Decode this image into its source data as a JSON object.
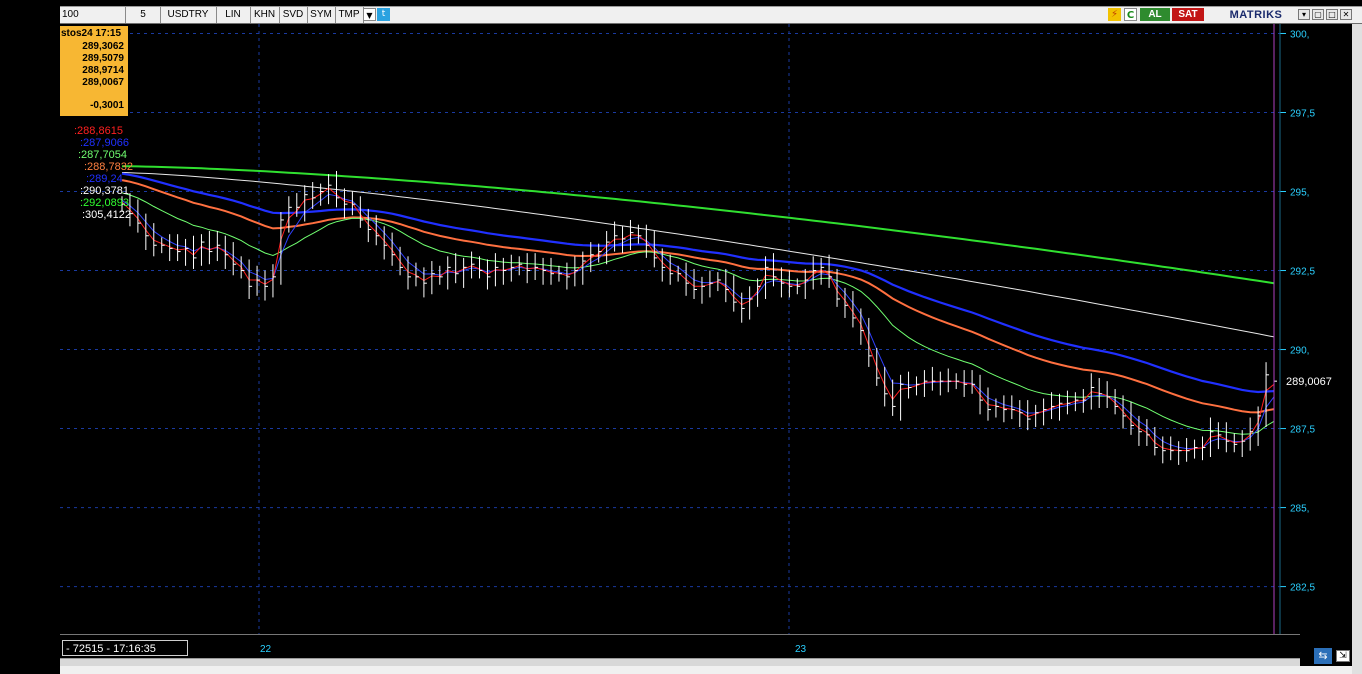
{
  "toolbar": {
    "period": "100",
    "interval": "5",
    "symbol": "USDTRY",
    "buttons": [
      "LIN",
      "KHN",
      "SVD",
      "SYM",
      "TMP"
    ],
    "buy_label": "AL",
    "sell_label": "SAT",
    "brand": "MATRIKS",
    "window_buttons": [
      "▾",
      "▢",
      "□",
      "✕"
    ]
  },
  "info": {
    "title": "stos24 17:15",
    "open": "289,3062",
    "high": "289,5079",
    "low": "288,9714",
    "close": "289,0067",
    "change": "-0,3001"
  },
  "legend": [
    {
      "text": ":288,8615",
      "color": "#ff2020"
    },
    {
      "text": ":287,9066",
      "color": "#2030ff"
    },
    {
      "text": ":287,7054",
      "color": "#70ff70"
    },
    {
      "text": ":288,7832",
      "color": "#ff8040"
    },
    {
      "text": ":289,24",
      "color": "#2030ff"
    },
    {
      "text": ":290,3781",
      "color": "#ffffff"
    },
    {
      "text": ":292,0893",
      "color": "#30ff30"
    },
    {
      "text": ":305,4122",
      "color": "#ffffff"
    }
  ],
  "status": "- 72515 - 17:16:35",
  "x_labels": [
    "22",
    "23"
  ],
  "chart_data": {
    "type": "line",
    "ylim": [
      281.0,
      300.3
    ],
    "yticks": [
      "300,",
      "297,5",
      "295,",
      "292,5",
      "290,",
      "287,5",
      "285,",
      "282,5"
    ],
    "ytick_values": [
      300,
      297.5,
      295,
      292.5,
      290,
      287.5,
      285,
      282.5
    ],
    "last_price_label": "289,0067",
    "last_price": 289.0067,
    "price_x": [
      0,
      2,
      4,
      6,
      8,
      10,
      12,
      14,
      16,
      18,
      20,
      22,
      24,
      26,
      28,
      30,
      32,
      34,
      36,
      38,
      40,
      42,
      44,
      46,
      48,
      50,
      52,
      54,
      56,
      58,
      60,
      62,
      64,
      66,
      68,
      70,
      72,
      74,
      76,
      78,
      80,
      82,
      84,
      86,
      88,
      90,
      92,
      94,
      96,
      98,
      100,
      102,
      104,
      106,
      108,
      110,
      112,
      114,
      116,
      118,
      120,
      122,
      124,
      126,
      128,
      130,
      132,
      134,
      136,
      138,
      140,
      142,
      144,
      146,
      148,
      150,
      152,
      154,
      156,
      158,
      160,
      162,
      164,
      166,
      168,
      170,
      172,
      174,
      176,
      178,
      180,
      182,
      184,
      186,
      188,
      190,
      192,
      194,
      196,
      198,
      200,
      202,
      204,
      206,
      208,
      210,
      212,
      214,
      216,
      218,
      220,
      222,
      224,
      226,
      228,
      230,
      232,
      234,
      236,
      238,
      240,
      242,
      244,
      246,
      248,
      250,
      252,
      254,
      256,
      258,
      260,
      262,
      264,
      266,
      268,
      270,
      272,
      274,
      276,
      278,
      280,
      282,
      284,
      286,
      288,
      290,
      292,
      294,
      296,
      298,
      300,
      302,
      304,
      306,
      308,
      310,
      312,
      314,
      316,
      318,
      320,
      322,
      324,
      326,
      328,
      330,
      332,
      334,
      336,
      338,
      340,
      342,
      344,
      346,
      348,
      350,
      352,
      354,
      356,
      358,
      360,
      362,
      364,
      366,
      368,
      370,
      372,
      374,
      376,
      378,
      380,
      382,
      384,
      386,
      388,
      390,
      392,
      394,
      396,
      398,
      400,
      402,
      404,
      406,
      408,
      410,
      412,
      414,
      416,
      418,
      420,
      422,
      424,
      426,
      428,
      430,
      432,
      434,
      436,
      438,
      440,
      442,
      444,
      446,
      448,
      450,
      452,
      454,
      456,
      458,
      460,
      462,
      464,
      466,
      468,
      470,
      472,
      474,
      476,
      478,
      480,
      482,
      484,
      486,
      488,
      490,
      492,
      494,
      496,
      498,
      500,
      502,
      504,
      506,
      508,
      510,
      512,
      514,
      516,
      518,
      520,
      522,
      524,
      526,
      528,
      530,
      532,
      534,
      536,
      538,
      540,
      542,
      544,
      546,
      548,
      550,
      552,
      554,
      556,
      558,
      560,
      562,
      564,
      566,
      568,
      570,
      572,
      574,
      576,
      578,
      580,
      582,
      584,
      586,
      588,
      590,
      592,
      594
    ],
    "price": [
      294.6,
      294.3,
      294.0,
      293.6,
      293.3,
      293.3,
      293.2,
      293.1,
      293.2,
      292.9,
      293.4,
      293.1,
      293.3,
      293.0,
      292.7,
      292.5,
      292.0,
      292.2,
      292.0,
      292.3,
      294.1,
      294.5,
      294.5,
      294.9,
      294.8,
      295.0,
      295.2,
      294.8,
      294.6,
      294.6,
      294.1,
      293.8,
      293.6,
      293.3,
      293.0,
      292.6,
      292.3,
      292.3,
      292.1,
      292.4,
      292.3,
      292.6,
      292.4,
      292.6,
      292.7,
      292.5,
      292.3,
      292.6,
      292.5,
      292.6,
      292.7,
      292.5,
      292.6,
      292.5,
      292.4,
      292.4,
      292.3,
      292.5,
      292.8,
      293.0,
      293.1,
      293.4,
      293.6,
      293.5,
      293.7,
      293.6,
      293.3,
      292.9,
      292.6,
      292.4,
      292.4,
      292.1,
      291.9,
      292.0,
      292.1,
      292.2,
      291.9,
      291.5,
      291.3,
      291.6,
      292.0,
      292.6,
      292.3,
      292.1,
      292.0,
      292.0,
      292.2,
      292.5,
      292.6,
      292.3,
      291.6,
      291.4,
      291.0,
      290.6,
      289.8,
      289.1,
      288.6,
      288.2,
      288.9,
      288.8,
      288.9,
      289.0,
      289.0,
      289.0,
      289.0,
      289.0,
      288.9,
      288.9,
      288.4,
      288.1,
      288.2,
      288.1,
      288.1,
      288.0,
      287.8,
      288.0,
      288.1,
      288.2,
      288.3,
      288.3,
      288.4,
      288.4,
      288.8,
      288.6,
      288.5,
      288.2,
      287.9,
      287.6,
      287.4,
      287.3,
      286.9,
      286.8,
      286.8,
      286.8,
      286.8,
      286.9,
      286.9,
      287.4,
      287.3,
      287.1,
      287.0,
      287.1,
      287.4,
      287.9,
      289.2,
      289.0
    ],
    "series": []
  }
}
